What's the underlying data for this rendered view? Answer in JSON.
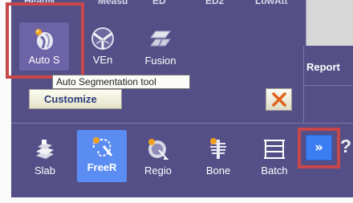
{
  "top_row": [
    "HeadN",
    "Measu",
    "ED",
    "ED2",
    "LowAtt"
  ],
  "toolbar_top": [
    {
      "label": "Auto S",
      "icon": "auto-segmentation-icon"
    },
    {
      "label": "VEn",
      "icon": "vessel-enhance-icon"
    },
    {
      "label": "Fusion",
      "icon": "fusion-icon"
    }
  ],
  "tooltip": "Auto Segmentation tool",
  "customize_label": "Customize",
  "report_label": "Report",
  "toolbar_bottom": [
    {
      "label": "Slab",
      "icon": "slab-icon"
    },
    {
      "label": "FreeR",
      "icon": "free-roi-icon"
    },
    {
      "label": "Regio",
      "icon": "region-icon"
    },
    {
      "label": "Bone",
      "icon": "bone-icon"
    },
    {
      "label": "Batch",
      "icon": "batch-icon"
    }
  ],
  "more_label": "»",
  "help_label": "?",
  "colors": {
    "panel": "#544f86",
    "selected": "#5b8cf2",
    "highlight": "#c7474a",
    "more_button": "#3b7ef4"
  }
}
